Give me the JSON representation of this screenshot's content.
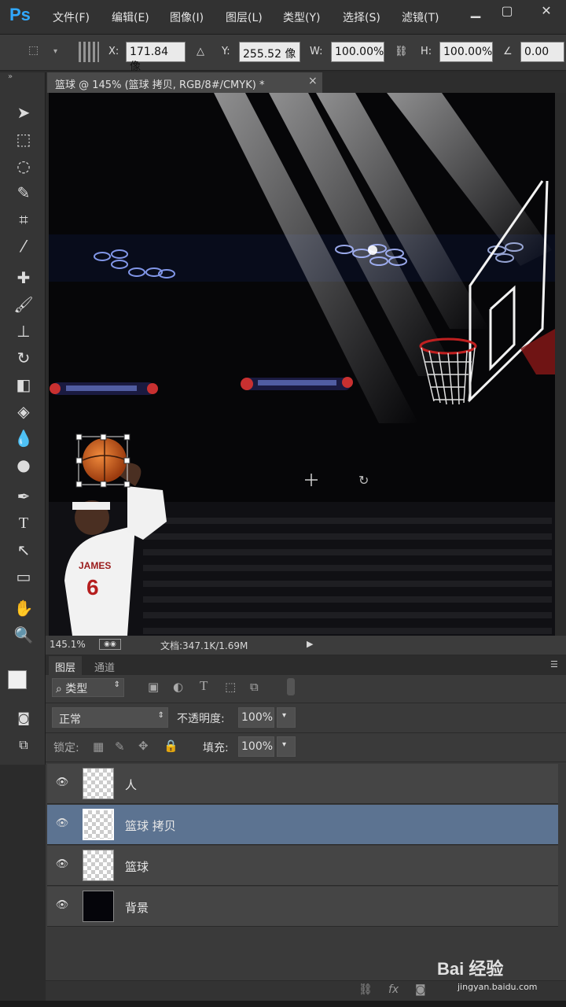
{
  "app": {
    "logo": "Ps"
  },
  "menu": [
    "文件(F)",
    "编辑(E)",
    "图像(I)",
    "图层(L)",
    "类型(Y)",
    "选择(S)",
    "滤镜(T)"
  ],
  "options": {
    "x_label": "X:",
    "x_value": "171.84 像",
    "y_label": "Y:",
    "y_value": "255.52 像",
    "w_label": "W:",
    "w_value": "100.00%",
    "h_label": "H:",
    "h_value": "100.00%",
    "angle_value": "0.00"
  },
  "document": {
    "tab_title": "篮球 @ 145% (篮球 拷贝, RGB/8#/CMYK) *",
    "close": "×"
  },
  "status": {
    "zoom": "145.1%",
    "doc_info": "文档:347.1K/1.69M"
  },
  "panel": {
    "tabs": [
      "图层",
      "通道"
    ],
    "filter_kind": "类型",
    "blend_mode": "正常",
    "opacity_label": "不透明度:",
    "opacity_value": "100%",
    "lock_label": "锁定:",
    "fill_label": "填充:",
    "fill_value": "100%",
    "layers": [
      {
        "name": "人",
        "selected": false
      },
      {
        "name": "篮球 拷贝",
        "selected": true
      },
      {
        "name": "篮球",
        "selected": false
      },
      {
        "name": "背景",
        "selected": false
      }
    ]
  },
  "watermark": {
    "brand": "Bai 经验",
    "url": "jingyan.baidu.com"
  },
  "colors": {
    "accent": "#31a8ff",
    "selection": "#5c7391"
  }
}
